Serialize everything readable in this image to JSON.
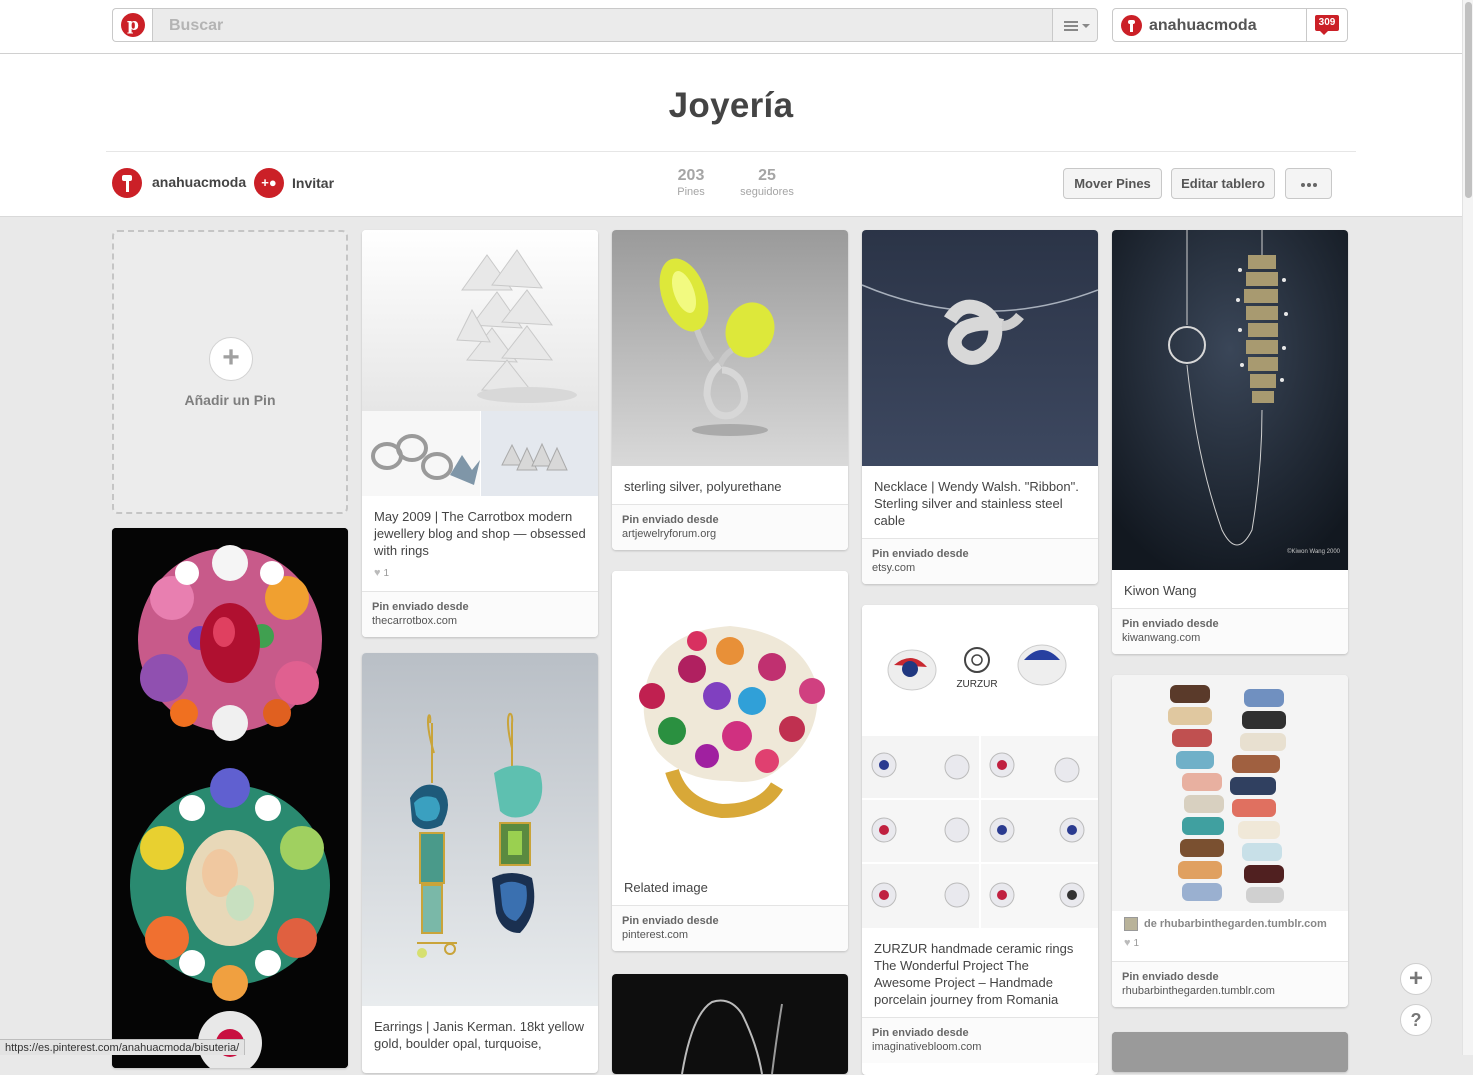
{
  "topbar": {
    "logo_letter": "p",
    "search_placeholder": "Buscar",
    "username": "anahuacmoda",
    "notifications": "309"
  },
  "board": {
    "title": "Joyería",
    "owner": "anahuacmoda",
    "invite_label": "Invitar",
    "invite_icon_text": "+",
    "stats": [
      {
        "value": "203",
        "label": "Pines"
      },
      {
        "value": "25",
        "label": "seguidores"
      }
    ],
    "buttons": {
      "move_pins": "Mover Pines",
      "edit_board": "Editar tablero"
    }
  },
  "add_pin": {
    "plus": "+",
    "label": "Añadir un Pin"
  },
  "pins": [
    {
      "description": "May 2009 | The Carrotbox modern jewellery blog and shop — obsessed with rings",
      "likes": "1",
      "source_label": "Pin enviado desde",
      "source": "thecarrotbox.com"
    },
    {
      "description": "sterling silver, polyurethane",
      "source_label": "Pin enviado desde",
      "source": "artjewelryforum.org"
    },
    {
      "description": "Necklace | Wendy Walsh. \"Ribbon\". Sterling silver and stainless steel cable",
      "source_label": "Pin enviado desde",
      "source": "etsy.com"
    },
    {
      "description": "Kiwon Wang",
      "image_caption": "©Kiwon Wang 2000",
      "source_label": "Pin enviado desde",
      "source": "kiwanwang.com"
    },
    {
      "description": "Related image",
      "source_label": "Pin enviado desde",
      "source": "pinterest.com"
    },
    {
      "description": "ZURZUR handmade ceramic rings The Wonderful Project The Awesome Project – Handmade porcelain journey from Romania",
      "source_label": "Pin enviado desde",
      "source": "imaginativebloom.com"
    },
    {
      "via": "de rhubarbinthegarden.tumblr.com",
      "likes": "1",
      "source_label": "Pin enviado desde",
      "source": "rhubarbinthegarden.tumblr.com"
    },
    {
      "description": "Earrings | Janis Kerman. 18kt yellow gold, boulder opal, turquoise,"
    }
  ],
  "floating": {
    "add": "+",
    "help": "?"
  },
  "status_url": "https://es.pinterest.com/anahuacmoda/bisuteria/",
  "colors": {
    "brand_red": "#cb2027",
    "background": "#e9e9e9"
  },
  "icons": [
    "pinterest-logo-icon",
    "menu-lines-icon",
    "pushpin-icon",
    "notification-icon",
    "add-user-icon",
    "more-dots-icon",
    "plus-icon",
    "heart-icon",
    "help-icon"
  ]
}
